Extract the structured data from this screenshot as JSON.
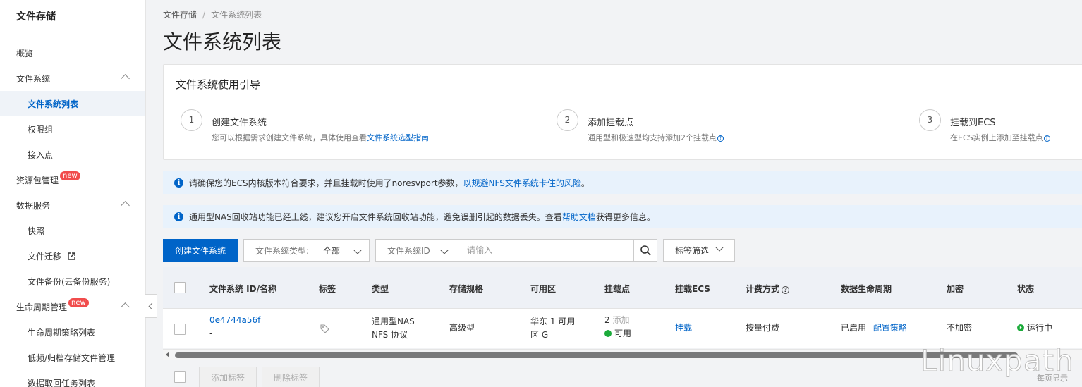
{
  "sidebar": {
    "title": "文件存储",
    "items": [
      {
        "label": "概览"
      },
      {
        "label": "文件系统"
      },
      {
        "label": "文件系统列表"
      },
      {
        "label": "权限组"
      },
      {
        "label": "接入点"
      },
      {
        "label": "资源包管理",
        "badge": "new"
      },
      {
        "label": "数据服务"
      },
      {
        "label": "快照"
      },
      {
        "label": "文件迁移"
      },
      {
        "label": "文件备份(云备份服务)"
      },
      {
        "label": "生命周期管理",
        "badge": "new"
      },
      {
        "label": "生命周期策略列表"
      },
      {
        "label": "低频/归档存储文件管理"
      },
      {
        "label": "数据取回任务列表"
      }
    ]
  },
  "breadcrumb": {
    "root": "文件存储",
    "separator": "/",
    "current": "文件系统列表"
  },
  "page_title": "文件系统列表",
  "guide": {
    "title": "文件系统使用引导",
    "steps": [
      {
        "num": "1",
        "title": "创建文件系统",
        "desc": "您可以根据需求创建文件系统，具体使用查看",
        "link": "文件系统选型指南"
      },
      {
        "num": "2",
        "title": "添加挂载点",
        "desc": "通用型和极速型均支持添加2个挂载点"
      },
      {
        "num": "3",
        "title": "挂载到ECS",
        "desc": "在ECS实例上添加至挂载点"
      }
    ]
  },
  "notices": [
    {
      "text": "请确保您的ECS内核版本符合要求，并且挂载时使用了noresvport参数，",
      "link": "以规避NFS文件系统卡住的风险",
      "suffix": "。"
    },
    {
      "text": "通用型NAS回收站功能已经上线，建议您开启文件系统回收站功能，避免误删引起的数据丢失。查看",
      "link": "帮助文档",
      "suffix": "获得更多信息。"
    }
  ],
  "toolbar": {
    "create_label": "创建文件系统",
    "type_filter_label": "文件系统类型:",
    "type_filter_value": "全部",
    "search_field": "文件系统ID",
    "search_placeholder": "请输入",
    "tag_filter_label": "标签筛选"
  },
  "table": {
    "headers": [
      "文件系统 ID/名称",
      "标签",
      "类型",
      "存储规格",
      "可用区",
      "挂载点",
      "挂载ECS",
      "计费方式",
      "数据生命周期",
      "加密",
      "状态"
    ],
    "rows": [
      {
        "id": "0e4744a56f",
        "name": "-",
        "type_line1": "通用型NAS",
        "type_line2": "NFS 协议",
        "spec": "高级型",
        "zone_line1": "华东 1 可用",
        "zone_line2": "区 G",
        "mount_count": "2",
        "mount_add": "添加",
        "mount_status": "可用",
        "mount_ecs": "挂载",
        "billing": "按量付费",
        "lifecycle_status": "已启用",
        "lifecycle_link": "配置策略",
        "encryption": "不加密",
        "status": "运行中"
      }
    ]
  },
  "bottom": {
    "add_tag": "添加标签",
    "delete_tag": "删除标签",
    "page_size_label": "每页显示"
  },
  "watermark": "Linuxpath",
  "colors": {
    "primary": "#0064c8",
    "notice_bg": "#e8f2fc",
    "status_green": "#1bab3a",
    "badge_red": "#f14c4c"
  }
}
